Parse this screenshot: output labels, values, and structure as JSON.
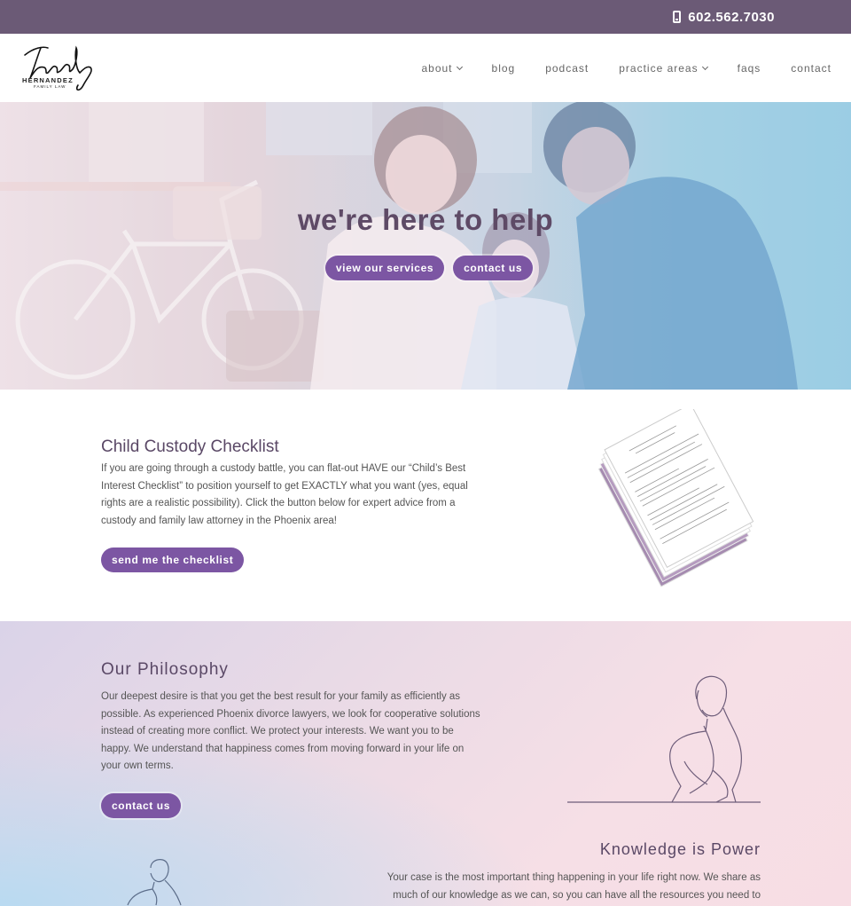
{
  "topbar": {
    "phone": "602.562.7030"
  },
  "logo": {
    "name": "HERNANDEZ",
    "sub": "FAMILY LAW"
  },
  "nav": {
    "about": "about",
    "blog": "blog",
    "podcast": "podcast",
    "practice_areas": "practice areas",
    "faqs": "faqs",
    "contact": "contact"
  },
  "hero": {
    "title": "we're here to help",
    "services_button": "view our services",
    "contact_button": "contact us"
  },
  "checklist": {
    "title": "Child Custody Checklist",
    "body": "If you are going through a custody battle, you can flat-out HAVE our “Child’s Best Interest Checklist” to position yourself to get EXACTLY what you want (yes, equal rights are a realistic possibility). Click the button below for expert advice from a custody and family law attorney in the Phoenix area!",
    "button": "send me the checklist"
  },
  "philosophy": {
    "title": "Our Philosophy",
    "body": "Our deepest desire is that you get the best result for your family as efficiently as possible. As experienced Phoenix divorce lawyers, we look for cooperative solutions instead of creating more conflict. We protect your interests. We want you to be happy. We understand that happiness comes from moving forward in your life on your own terms.",
    "button": "contact us"
  },
  "knowledge": {
    "title": "Knowledge is Power",
    "body": "Your case is the most important thing happening in your life right now. We share as much of our knowledge as we can, so you can have all the resources you need to"
  },
  "colors": {
    "topbar": "#6b5a76",
    "accent": "#7c56a3",
    "heading": "#5a4866"
  }
}
